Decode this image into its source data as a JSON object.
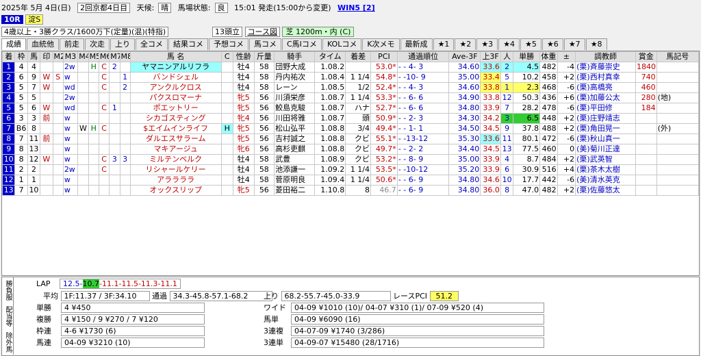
{
  "header": {
    "date": "2025年 5月 4日(日)",
    "meeting": "2回京都4日目",
    "weather_label": "天候:",
    "weather": "晴",
    "track_label": "馬場状態:",
    "track": "良",
    "start": "15:01 発走(15:00から変更)",
    "win5": "WIN5 [2]",
    "race_no": "10R",
    "race_name": "淀S",
    "conditions": "4歳以上・3勝クラス/1600万下(定量)(混)(特指)",
    "field_size": "13頭立",
    "course_btn": "コース図",
    "course": "芝 1200m・内 (C)"
  },
  "tabs": [
    "成績",
    "血統他",
    "前走",
    "次走",
    "上り",
    "全コメ",
    "結果コメ",
    "予想コメ",
    "馬コメ",
    "C馬Iコメ",
    "KOLコメ",
    "K次メモ",
    "最新成",
    "★1",
    "★2",
    "★3",
    "★4",
    "★5",
    "★6",
    "★7",
    "★8"
  ],
  "columns": [
    "着",
    "枠",
    "馬",
    "印",
    "M2",
    "M3",
    "M4",
    "M5",
    "M6",
    "M7",
    "M8",
    "馬 名",
    "C",
    "性齢",
    "斤量",
    "騎手",
    "タイム",
    "着差",
    "PCI",
    "通過順位",
    "Ave-3F",
    "上3F",
    "人",
    "単勝",
    "体重",
    "±",
    "調教師",
    "賞金",
    "馬記号"
  ],
  "rows": [
    [
      "1",
      "4",
      "4",
      "",
      "",
      "2w",
      "",
      "H",
      "C",
      "2",
      "",
      "ヤマニンアルリフラ",
      "",
      "牡4",
      "58",
      "団野大成",
      "1.08.2",
      "",
      "53.0*",
      "- - 4- 3",
      "34.60",
      "33.6",
      "2",
      "4.5",
      "482",
      "-4",
      "(栗)斉藤崇史",
      "1840",
      ""
    ],
    [
      "2",
      "6",
      "9",
      "W",
      "S",
      "w",
      "",
      "",
      "C",
      "",
      "1",
      "バンドシェル",
      "",
      "牡4",
      "58",
      "丹内祐次",
      "1.08.4",
      "1 1/4",
      "54.8*",
      "- -10- 9",
      "35.00",
      "33.4",
      "5",
      "10.2",
      "458",
      "+2",
      "(栗)西村真幸",
      "740",
      ""
    ],
    [
      "3",
      "5",
      "7",
      "W",
      "",
      "wd",
      "",
      "",
      "C",
      "",
      "2",
      "アンクルクロス",
      "",
      "牡4",
      "58",
      "レーン",
      "1.08.5",
      "1/2",
      "52.4*",
      "- - 4- 3",
      "34.60",
      "33.8",
      "1",
      "2.3",
      "468",
      "-6",
      "(栗)高橋亮",
      "460",
      ""
    ],
    [
      "4",
      "5",
      "5",
      "",
      "",
      "2w",
      "",
      "",
      "",
      "",
      "",
      "パクスロマーナ",
      "",
      "牝5",
      "56",
      "川須栄彦",
      "1.08.7",
      "1 1/4",
      "53.3*",
      "- - 6- 6",
      "34.90",
      "33.8",
      "12",
      "50.3",
      "436",
      "+6",
      "(栗)加藤公太",
      "280",
      "(地)"
    ],
    [
      "5",
      "5",
      "6",
      "W",
      "",
      "wd",
      "",
      "",
      "C",
      "1",
      "",
      "ポエットリー",
      "",
      "牝5",
      "56",
      "鮫島克駿",
      "1.08.7",
      "ハナ",
      "52.7*",
      "- - 6- 6",
      "34.80",
      "33.9",
      "7",
      "28.2",
      "478",
      "-6",
      "(栗)平田修",
      "184",
      ""
    ],
    [
      "6",
      "3",
      "3",
      "前",
      "",
      "w",
      "",
      "",
      "",
      "",
      "",
      "シカゴスティング",
      "",
      "牝4",
      "56",
      "川田将雅",
      "1.08.7",
      "頭",
      "50.9*",
      "- - 2- 3",
      "34.30",
      "34.2",
      "3",
      "6.5",
      "448",
      "+2",
      "(栗)庄野靖志",
      "",
      ""
    ],
    [
      "7",
      "B6",
      "8",
      "",
      "",
      "w",
      "W",
      "H",
      "C",
      "",
      "",
      "$エイムインライフ",
      "H",
      "牝5",
      "56",
      "松山弘平",
      "1.08.8",
      "3/4",
      "49.4*",
      "- - 1- 1",
      "34.50",
      "34.5",
      "9",
      "37.8",
      "488",
      "+2",
      "(栗)角田晃一",
      "",
      "(外)"
    ],
    [
      "8",
      "7",
      "11",
      "前",
      "",
      "w",
      "",
      "",
      "",
      "",
      "",
      "ダルエスサラーム",
      "",
      "牝5",
      "56",
      "吉村誠之",
      "1.08.8",
      "クビ",
      "55.1*",
      "- -13-12",
      "35.30",
      "33.6",
      "11",
      "80.1",
      "472",
      "-6",
      "(栗)秋山真一",
      "",
      ""
    ],
    [
      "9",
      "8",
      "13",
      "",
      "",
      "w",
      "",
      "",
      "",
      "",
      "",
      "マキアージュ",
      "",
      "牝6",
      "56",
      "高杉吏麒",
      "1.08.8",
      "クビ",
      "49.7*",
      "- - 2- 2",
      "34.40",
      "34.5",
      "13",
      "77.5",
      "460",
      "0",
      "(美)菊川正達",
      "",
      ""
    ],
    [
      "10",
      "8",
      "12",
      "W",
      "",
      "w",
      "",
      "",
      "C",
      "3",
      "3",
      "ミルテンベルク",
      "",
      "牡4",
      "58",
      "武豊",
      "1.08.9",
      "クビ",
      "53.2*",
      "- - 8- 9",
      "35.00",
      "33.9",
      "4",
      "8.7",
      "484",
      "+2",
      "(栗)武英智",
      "",
      ""
    ],
    [
      "11",
      "2",
      "2",
      "",
      "",
      "2w",
      "",
      "",
      "C",
      "",
      "",
      "リシャールケリー",
      "",
      "牡4",
      "58",
      "池添謙一",
      "1.09.2",
      "1 1/4",
      "53.5*",
      "- -10-12",
      "35.20",
      "33.9",
      "6",
      "30.9",
      "516",
      "+4",
      "(栗)茶木太樹",
      "",
      ""
    ],
    [
      "12",
      "1",
      "1",
      "",
      "",
      "w",
      "",
      "",
      "",
      "",
      "",
      "アララララ",
      "",
      "牡4",
      "58",
      "菅原明良",
      "1.09.4",
      "1 1/4",
      "50.6*",
      "- - 6- 9",
      "34.80",
      "34.6",
      "10",
      "17.7",
      "442",
      "-6",
      "(美)清水英克",
      "",
      ""
    ],
    [
      "13",
      "7",
      "10",
      "",
      "",
      "w",
      "",
      "",
      "",
      "",
      "",
      "オックスリップ",
      "",
      "牝5",
      "56",
      "菱田裕二",
      "1.10.8",
      "8",
      "46.7",
      "- - 6- 9",
      "34.80",
      "36.0",
      "8",
      "47.0",
      "482",
      "+2",
      "(栗)佐藤悠太",
      "",
      ""
    ]
  ],
  "bottom": {
    "side_labels": [
      "勝負服",
      "配当等",
      "除外馬"
    ],
    "lap_label": "LAP",
    "lap_1": "12.5-",
    "lap_2": "10.7",
    "lap_3": "-11.1-11.5-11.3-11.1",
    "avg_label": "平均",
    "avg": "1F:11.37 / 3F:34.10",
    "pass_label": "通過",
    "pass": "34.3-45.8-57.1-68.2",
    "agari_label": "上り",
    "agari": "68.2-55.7-45.0-33.9",
    "rpci_label": "レースPCI",
    "rpci": "51.2",
    "payouts_left": [
      {
        "label": "単勝",
        "value": "4 ¥450"
      },
      {
        "label": "複勝",
        "value": "4 ¥150 / 9 ¥270 / 7 ¥120"
      },
      {
        "label": "枠連",
        "value": "4-6 ¥1730 (6)"
      },
      {
        "label": "馬連",
        "value": "04-09 ¥3210 (10)"
      }
    ],
    "payouts_right": [
      {
        "label": "ワイド",
        "value": "04-09 ¥1010 (10)/ 04-07 ¥310 (1)/ 07-09 ¥520 (4)"
      },
      {
        "label": "馬単",
        "value": "04-09 ¥6090 (16)"
      },
      {
        "label": "3連複",
        "value": "04-07-09 ¥1740 (3/286)"
      },
      {
        "label": "3連単",
        "value": "04-09-07 ¥15480 (28/1716)"
      }
    ]
  }
}
